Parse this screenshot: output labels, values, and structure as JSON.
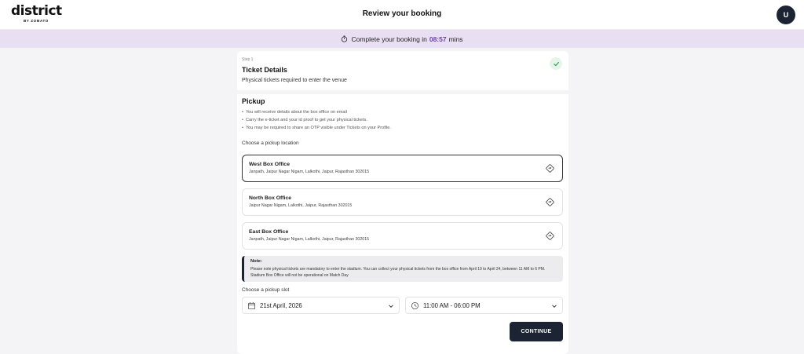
{
  "header": {
    "logo_word": "district",
    "logo_sub": "BY ZOMATO",
    "title": "Review your booking",
    "avatar_initial": "U"
  },
  "timer": {
    "prefix": "Complete your booking in",
    "time": "08:57",
    "suffix": "mins",
    "accent_color": "#6c3fb5"
  },
  "step": {
    "label": "Step 1",
    "title": "Ticket Details",
    "subtitle": "Physical tickets required to enter the venue",
    "completed": true
  },
  "pickup": {
    "title": "Pickup",
    "bullets": [
      "You will receive details about the box office on email",
      "Carry the e-ticket and your id proof to get your physical tickets.",
      "You may be required to share an OTP visible under Tickets on your Profile."
    ],
    "choose_location_label": "Choose a pickup location",
    "locations": [
      {
        "name": "West Box Office",
        "address": "Janpath, Jaipur Nagar Nigam, Lalkothi, Jaipur, Rajasthan 302015",
        "selected": true
      },
      {
        "name": "North Box Office",
        "address": "Jaipur Nagar Nigam, Lalkothi, Jaipur, Rajasthan 302015",
        "selected": false
      },
      {
        "name": "East Box Office",
        "address": "Janpath, Jaipur Nagar Nigam, Lalkothi, Jaipur, Rajasthan 302015",
        "selected": false
      }
    ]
  },
  "note": {
    "title": "Note:",
    "body": "Please note physical tickets are mandatory to enter the stadium. You can collect your physical tickets from the box office from April 19 to April 24, between 11 AM to 6 PM. Stadium Box Office will not be operational on Match Day"
  },
  "slot": {
    "label": "Choose a pickup slot",
    "date": "21st April, 2026",
    "time": "11:00 AM - 06:00 PM"
  },
  "actions": {
    "continue_label": "CONTINUE"
  },
  "colors": {
    "brand_dark": "#1c2333",
    "timer_bg": "#e9dff3",
    "check_green": "#2e9e57"
  }
}
